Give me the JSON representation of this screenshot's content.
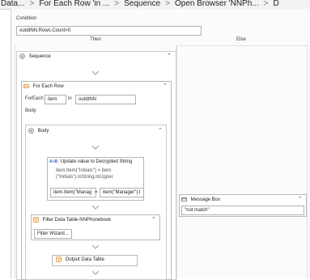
{
  "breadcrumb": {
    "items": [
      "Data...",
      "For Each Row 'in ...",
      "Sequence",
      "Open Browser 'NNPh...",
      "D"
    ]
  },
  "condition": {
    "label": "Condition",
    "expression": "outdtNN.Rows.Count>0",
    "then_label": "Then",
    "else_label": "Else"
  },
  "sequence": {
    "title": "Sequence"
  },
  "foreach": {
    "title": "For Each Row",
    "foreach_label": "ForEach",
    "item_value": "item",
    "in_label": "in",
    "collection_value": "outdtNN",
    "body_label": "Body"
  },
  "body_seq": {
    "title": "Body"
  },
  "assign": {
    "title": "Update value to Decrypted String",
    "description_line1": "item.Item(\"Initials\") = item",
    "description_line2": "(\"Initials\").toString.toUpper",
    "left_value": "item.Item(\"Manag",
    "equals": "=",
    "right_value": "item(\"Manager\").t"
  },
  "filter": {
    "title": "Filter Data Table-NNPhonebook",
    "button_label": "Filter Wizard..."
  },
  "output": {
    "title": "Output Data Table"
  },
  "messagebox": {
    "title": "Message Box",
    "text_value": "\"not match\""
  },
  "colors": {
    "accent": "#2b6cb0",
    "icon_orange": "#e07b00",
    "border": "#b9b9b9"
  }
}
